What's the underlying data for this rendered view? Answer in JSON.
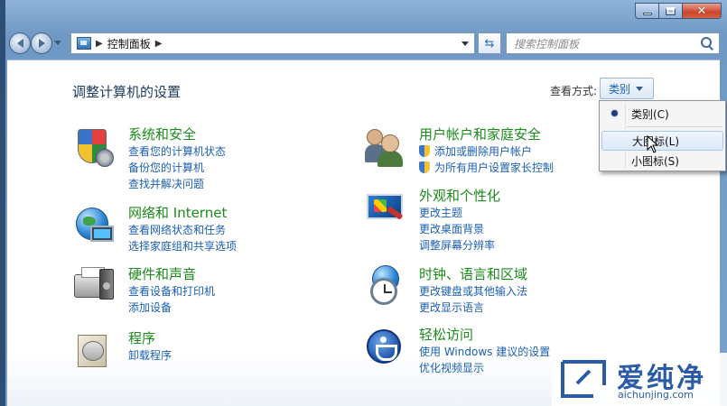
{
  "address": {
    "breadcrumb": "控制面板"
  },
  "search": {
    "placeholder": "搜索控制面板"
  },
  "main": {
    "title": "调整计算机的设置",
    "view_by_label": "查看方式:",
    "view_by_value": "类别"
  },
  "categories": [
    {
      "id": "system-security",
      "icon": "shield-icon",
      "title": "系统和安全",
      "links": [
        "查看您的计算机状态",
        "备份您的计算机",
        "查找并解决问题"
      ]
    },
    {
      "id": "network-internet",
      "icon": "network-globe-icon",
      "title": "网络和 Internet",
      "links": [
        "查看网络状态和任务",
        "选择家庭组和共享选项"
      ]
    },
    {
      "id": "hardware-sound",
      "icon": "printer-icon",
      "title": "硬件和声音",
      "links": [
        "查看设备和打印机",
        "添加设备"
      ]
    },
    {
      "id": "programs",
      "icon": "programs-box-icon",
      "title": "程序",
      "links": [
        "卸载程序"
      ]
    },
    {
      "id": "user-accounts",
      "icon": "users-icon",
      "title": "用户帐户和家庭安全",
      "links": [
        "添加或删除用户帐户",
        "为所有用户设置家长控制"
      ]
    },
    {
      "id": "appearance",
      "icon": "display-personalization-icon",
      "title": "外观和个性化",
      "links": [
        "更改主题",
        "更改桌面背景",
        "调整屏幕分辨率"
      ]
    },
    {
      "id": "clock-language",
      "icon": "clock-globe-icon",
      "title": "时钟、语言和区域",
      "links": [
        "更改键盘或其他输入法",
        "更改显示语言"
      ]
    },
    {
      "id": "ease-of-access",
      "icon": "accessibility-icon",
      "title": "轻松访问",
      "links": [
        "使用 Windows 建议的设置",
        "优化视频显示"
      ]
    }
  ],
  "view_menu": {
    "items": [
      {
        "label": "类别(C)",
        "selected": true
      },
      {
        "label": "大图标(L)",
        "hovered": true
      },
      {
        "label": "小图标(S)"
      }
    ]
  },
  "watermark": {
    "brand": "爱纯净",
    "url": "aichunjing.com"
  },
  "colors": {
    "category_title": "#1a8c1a",
    "link": "#1a5fb4",
    "page_title": "#1e3a5f"
  }
}
